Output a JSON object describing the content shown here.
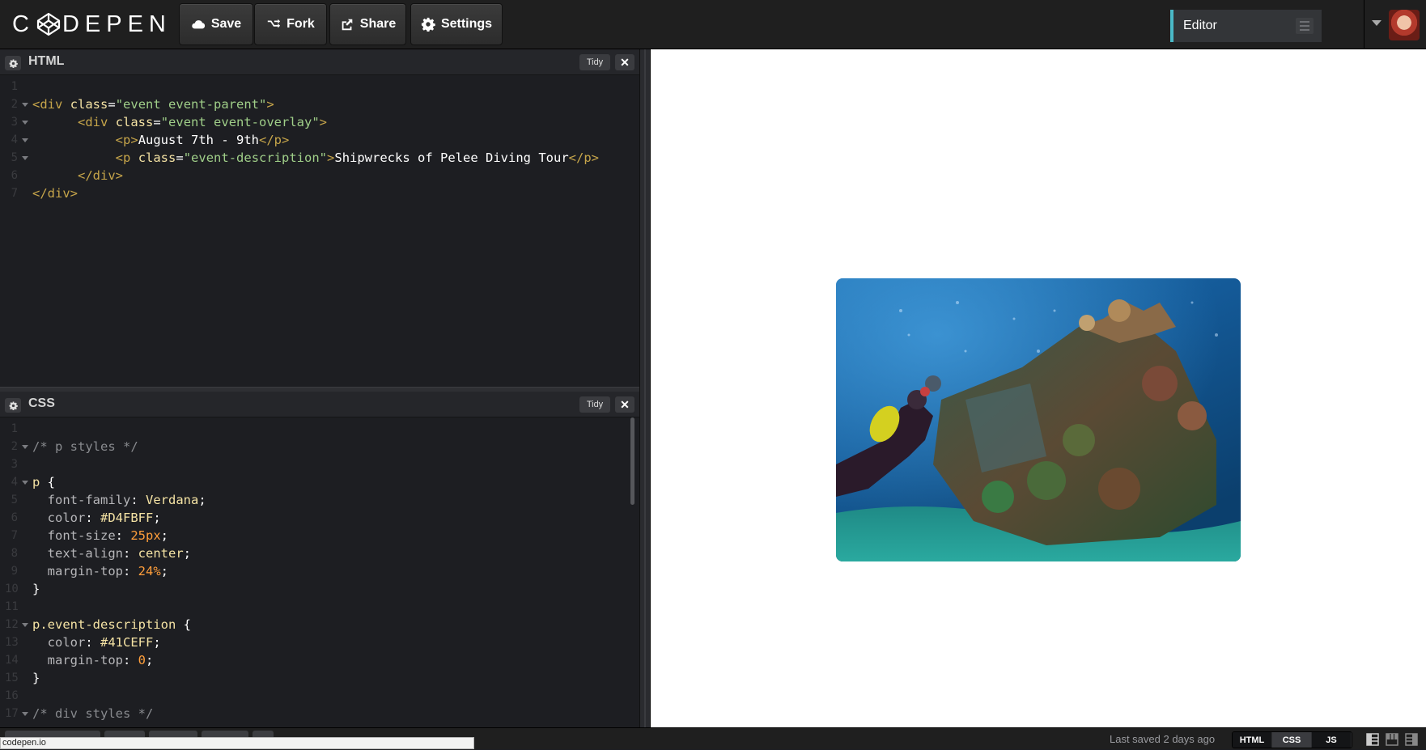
{
  "app": {
    "logo": "C DEPEN"
  },
  "toolbar": {
    "save_label": "Save",
    "fork_label": "Fork",
    "share_label": "Share",
    "settings_label": "Settings",
    "view_mode": "Editor"
  },
  "html_editor": {
    "title": "HTML",
    "tidy_label": "Tidy",
    "lines": [
      {
        "n": "1",
        "fold": false,
        "tokens": []
      },
      {
        "n": "2",
        "fold": true,
        "tokens": [
          {
            "c": "t-punc",
            "t": "<"
          },
          {
            "c": "t-tag",
            "t": "div"
          },
          {
            "c": "t-txt",
            "t": " "
          },
          {
            "c": "t-attr",
            "t": "class"
          },
          {
            "c": "t-txt",
            "t": "="
          },
          {
            "c": "t-str",
            "t": "\"event event-parent\""
          },
          {
            "c": "t-punc",
            "t": ">"
          }
        ]
      },
      {
        "n": "3",
        "fold": true,
        "tokens": [
          {
            "c": "t-txt",
            "t": "      "
          },
          {
            "c": "t-punc",
            "t": "<"
          },
          {
            "c": "t-tag",
            "t": "div"
          },
          {
            "c": "t-txt",
            "t": " "
          },
          {
            "c": "t-attr",
            "t": "class"
          },
          {
            "c": "t-txt",
            "t": "="
          },
          {
            "c": "t-str",
            "t": "\"event event-overlay\""
          },
          {
            "c": "t-punc",
            "t": ">"
          }
        ]
      },
      {
        "n": "4",
        "fold": true,
        "tokens": [
          {
            "c": "t-txt",
            "t": "           "
          },
          {
            "c": "t-punc",
            "t": "<"
          },
          {
            "c": "t-tag",
            "t": "p"
          },
          {
            "c": "t-punc",
            "t": ">"
          },
          {
            "c": "t-txt",
            "t": "August 7th - 9th"
          },
          {
            "c": "t-punc",
            "t": "</"
          },
          {
            "c": "t-tag",
            "t": "p"
          },
          {
            "c": "t-punc",
            "t": ">"
          }
        ]
      },
      {
        "n": "5",
        "fold": true,
        "tokens": [
          {
            "c": "t-txt",
            "t": "           "
          },
          {
            "c": "t-punc",
            "t": "<"
          },
          {
            "c": "t-tag",
            "t": "p"
          },
          {
            "c": "t-txt",
            "t": " "
          },
          {
            "c": "t-attr",
            "t": "class"
          },
          {
            "c": "t-txt",
            "t": "="
          },
          {
            "c": "t-str",
            "t": "\"event-description\""
          },
          {
            "c": "t-punc",
            "t": ">"
          },
          {
            "c": "t-txt",
            "t": "Shipwrecks of Pelee Diving Tour"
          },
          {
            "c": "t-punc",
            "t": "</"
          },
          {
            "c": "t-tag",
            "t": "p"
          },
          {
            "c": "t-punc",
            "t": ">"
          }
        ]
      },
      {
        "n": "6",
        "fold": false,
        "tokens": [
          {
            "c": "t-txt",
            "t": "      "
          },
          {
            "c": "t-punc",
            "t": "</"
          },
          {
            "c": "t-tag",
            "t": "div"
          },
          {
            "c": "t-punc",
            "t": ">"
          }
        ]
      },
      {
        "n": "7",
        "fold": false,
        "tokens": [
          {
            "c": "t-punc",
            "t": "</"
          },
          {
            "c": "t-tag",
            "t": "div"
          },
          {
            "c": "t-punc",
            "t": ">"
          }
        ]
      }
    ]
  },
  "css_editor": {
    "title": "CSS",
    "tidy_label": "Tidy",
    "lines": [
      {
        "n": "1",
        "fold": false,
        "tokens": []
      },
      {
        "n": "2",
        "fold": true,
        "tokens": [
          {
            "c": "t-com",
            "t": "/* p styles */"
          }
        ]
      },
      {
        "n": "3",
        "fold": false,
        "tokens": []
      },
      {
        "n": "4",
        "fold": true,
        "tokens": [
          {
            "c": "t-sel",
            "t": "p"
          },
          {
            "c": "t-txt",
            "t": " {"
          }
        ]
      },
      {
        "n": "5",
        "fold": false,
        "tokens": [
          {
            "c": "t-txt",
            "t": "  "
          },
          {
            "c": "t-prop",
            "t": "font-family"
          },
          {
            "c": "t-txt",
            "t": ": "
          },
          {
            "c": "t-val",
            "t": "Verdana"
          },
          {
            "c": "t-txt",
            "t": ";"
          }
        ]
      },
      {
        "n": "6",
        "fold": false,
        "tokens": [
          {
            "c": "t-txt",
            "t": "  "
          },
          {
            "c": "t-prop",
            "t": "color"
          },
          {
            "c": "t-txt",
            "t": ": "
          },
          {
            "c": "t-val",
            "t": "#D4FBFF"
          },
          {
            "c": "t-txt",
            "t": ";"
          }
        ]
      },
      {
        "n": "7",
        "fold": false,
        "tokens": [
          {
            "c": "t-txt",
            "t": "  "
          },
          {
            "c": "t-prop",
            "t": "font-size"
          },
          {
            "c": "t-txt",
            "t": ": "
          },
          {
            "c": "t-num",
            "t": "25px"
          },
          {
            "c": "t-txt",
            "t": ";"
          }
        ]
      },
      {
        "n": "8",
        "fold": false,
        "tokens": [
          {
            "c": "t-txt",
            "t": "  "
          },
          {
            "c": "t-prop",
            "t": "text-align"
          },
          {
            "c": "t-txt",
            "t": ": "
          },
          {
            "c": "t-val",
            "t": "center"
          },
          {
            "c": "t-txt",
            "t": ";"
          }
        ]
      },
      {
        "n": "9",
        "fold": false,
        "tokens": [
          {
            "c": "t-txt",
            "t": "  "
          },
          {
            "c": "t-prop",
            "t": "margin-top"
          },
          {
            "c": "t-txt",
            "t": ": "
          },
          {
            "c": "t-num",
            "t": "24%"
          },
          {
            "c": "t-txt",
            "t": ";"
          }
        ]
      },
      {
        "n": "10",
        "fold": false,
        "tokens": [
          {
            "c": "t-txt",
            "t": "}"
          }
        ]
      },
      {
        "n": "11",
        "fold": false,
        "tokens": []
      },
      {
        "n": "12",
        "fold": true,
        "tokens": [
          {
            "c": "t-sel",
            "t": "p.event-description"
          },
          {
            "c": "t-txt",
            "t": " {"
          }
        ]
      },
      {
        "n": "13",
        "fold": false,
        "tokens": [
          {
            "c": "t-txt",
            "t": "  "
          },
          {
            "c": "t-prop",
            "t": "color"
          },
          {
            "c": "t-txt",
            "t": ": "
          },
          {
            "c": "t-val",
            "t": "#41CEFF"
          },
          {
            "c": "t-txt",
            "t": ";"
          }
        ]
      },
      {
        "n": "14",
        "fold": false,
        "tokens": [
          {
            "c": "t-txt",
            "t": "  "
          },
          {
            "c": "t-prop",
            "t": "margin-top"
          },
          {
            "c": "t-txt",
            "t": ": "
          },
          {
            "c": "t-num",
            "t": "0"
          },
          {
            "c": "t-txt",
            "t": ";"
          }
        ]
      },
      {
        "n": "15",
        "fold": false,
        "tokens": [
          {
            "c": "t-txt",
            "t": "}"
          }
        ]
      },
      {
        "n": "16",
        "fold": false,
        "tokens": []
      },
      {
        "n": "17",
        "fold": true,
        "tokens": [
          {
            "c": "t-com",
            "t": "/* div styles */"
          }
        ]
      }
    ]
  },
  "footer": {
    "status_url": "codepen.io",
    "last_saved": "Last saved 2 days ago",
    "toggles": [
      "HTML",
      "CSS",
      "JS"
    ]
  },
  "icons": {
    "save": "cloud-icon",
    "fork": "fork-icon",
    "share": "share-icon",
    "settings": "gear-icon"
  },
  "colors": {
    "accent": "#4ab9c7",
    "editor_bg": "#1d1e22",
    "topbar_bg": "#1f1f1f"
  }
}
